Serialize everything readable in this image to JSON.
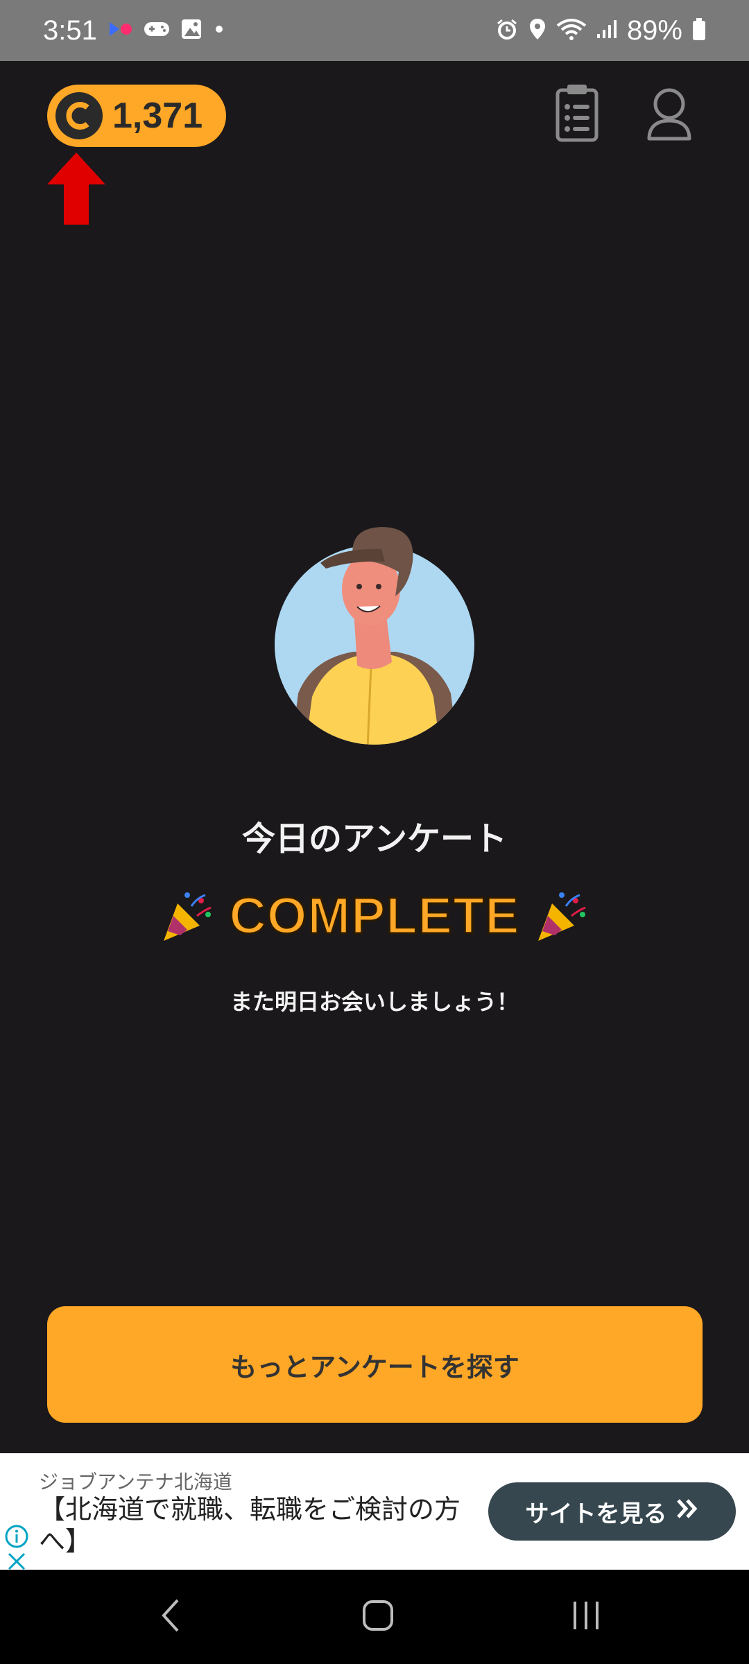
{
  "status_bar": {
    "time": "3:51",
    "battery_percent": "89%"
  },
  "header": {
    "coin_count": "1,371",
    "coin_symbol": "C"
  },
  "main": {
    "title": "今日のアンケート",
    "complete_label": "COMPLETE",
    "subtitle": "また明日お会いしましょう！",
    "more_button_label": "もっとアンケートを探す"
  },
  "ad": {
    "sponsor": "ジョブアンテナ北海道",
    "headline": "【北海道で就職、転職をご検討の方へ】",
    "cta_label": "サイトを見る"
  },
  "colors": {
    "accent": "#ffa726",
    "background": "#1a181b",
    "ad_button": "#37474f",
    "arrow": "#e00000"
  }
}
